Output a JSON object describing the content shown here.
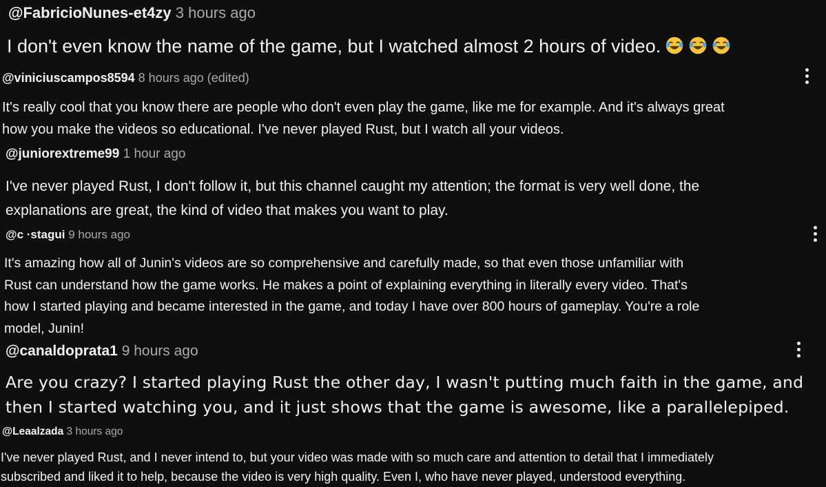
{
  "comments": [
    {
      "author": "@FabricioNunes-et4zy",
      "time": "3 hours ago",
      "lines": [
        "I don't even know the name of the game, but I watched almost 2 hours of video."
      ],
      "emoji": [
        "laughing-tears",
        "laughing-tears",
        "laughing-tears"
      ]
    },
    {
      "author": "@viniciuscampos8594",
      "time": "8 hours ago (edited)",
      "lines": [
        "It's really cool that you know there are people who don't even play the game, like me for example. And it's always great",
        "how you make the videos so educational. I've never played Rust, but I watch all your videos."
      ]
    },
    {
      "author": "@juniorextreme99",
      "time": "1 hour ago",
      "lines": [
        "I've never played Rust, I don't follow it, but this channel caught my attention; the format is very well done, the",
        "explanations are great, the kind of video that makes you want to play."
      ]
    },
    {
      "author": "@c ·stagui",
      "time": "9 hours ago",
      "lines": [
        "It's amazing how all of Junin's videos are so comprehensive and carefully made, so that even those unfamiliar with",
        "Rust can understand how the game works. He makes a point of explaining everything in literally every video. That's",
        "how I started playing and became interested in the game, and today I have over 800 hours of gameplay. You're a role",
        "model, Junin!"
      ]
    },
    {
      "author": "@canaldoprata1",
      "time": "9 hours ago",
      "lines": [
        "Are you crazy? I started playing Rust the other day, I wasn't putting much faith in the game, and",
        "then I started watching you, and it just shows that the game is awesome, like a parallelepiped."
      ]
    },
    {
      "author": "@Leaalzada",
      "time": "3 hours ago",
      "lines": [
        "I've never played Rust, and I never intend to, but your video was made with so much care and attention to detail that I immediately",
        "subscribed and liked it to help, because the video is very high quality. Even I, who have never played, understood everything."
      ]
    }
  ],
  "theme": {
    "background": "#0f0f0f",
    "text": "#f1f1f1",
    "muted": "#aaaaaa",
    "emoji_face": "#f5c542"
  },
  "icons": {
    "more": "more-vertical-icon",
    "emoji": "laughing-tears-emoji"
  }
}
